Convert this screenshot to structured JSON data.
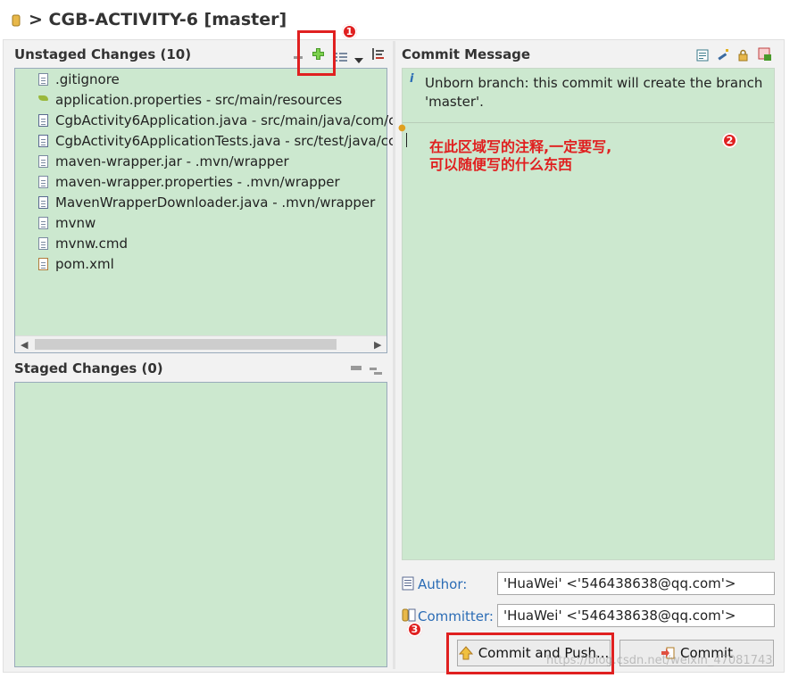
{
  "title": {
    "text": "> CGB-ACTIVITY-6 [master]"
  },
  "unstaged": {
    "heading": "Unstaged Changes (10)",
    "files": [
      {
        "name": ".gitignore",
        "icon": "text-file-icon"
      },
      {
        "name": "application.properties - src/main/resources",
        "icon": "properties-file-icon"
      },
      {
        "name": "CgbActivity6Application.java - src/main/java/com/c",
        "icon": "java-file-icon"
      },
      {
        "name": "CgbActivity6ApplicationTests.java - src/test/java/cc",
        "icon": "java-file-icon"
      },
      {
        "name": "maven-wrapper.jar - .mvn/wrapper",
        "icon": "text-file-icon"
      },
      {
        "name": "maven-wrapper.properties - .mvn/wrapper",
        "icon": "text-file-icon"
      },
      {
        "name": "MavenWrapperDownloader.java - .mvn/wrapper",
        "icon": "java-file-icon"
      },
      {
        "name": "mvnw",
        "icon": "text-file-icon"
      },
      {
        "name": "mvnw.cmd",
        "icon": "text-file-icon"
      },
      {
        "name": "pom.xml",
        "icon": "xml-file-icon"
      }
    ]
  },
  "staged": {
    "heading": "Staged Changes (0)"
  },
  "commit": {
    "heading": "Commit Message",
    "info": "Unborn branch: this commit will create the branch 'master'.",
    "note_line1": "在此区域写的注释,一定要写,",
    "note_line2": "可以随便写的什么东西",
    "author_label": "Author:",
    "author_value": "'HuaWei' <'546438638@qq.com'>",
    "committer_label": "Committer:",
    "committer_value": "'HuaWei' <'546438638@qq.com'>",
    "commit_push_label": "Commit and Push...",
    "commit_label": "Commit"
  },
  "badges": {
    "one": "1",
    "two": "2",
    "three": "3"
  },
  "watermark": "https://blog.csdn.net/weixin_47081743",
  "colors": {
    "panel_green": "#cce8cf",
    "annotation_red": "#e02020",
    "link_blue": "#2b6cb5"
  }
}
